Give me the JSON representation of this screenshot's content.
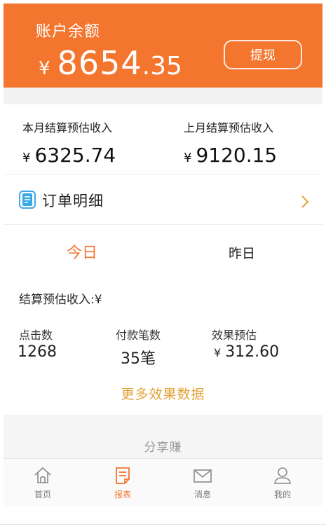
{
  "balance": {
    "label": "账户余额",
    "currency": "¥",
    "integer": "8654",
    "decimal": ".35",
    "withdraw_label": "提现"
  },
  "month_stats": {
    "this_month_label": "本月结算预估收入",
    "this_month_currency": "¥",
    "this_month_value": "6325.74",
    "last_month_label": "上月结算预估收入",
    "last_month_currency": "¥",
    "last_month_value": "9120.15"
  },
  "order_detail": {
    "label": "订单明细"
  },
  "tabs": {
    "today": "今日",
    "yesterday": "昨日"
  },
  "settle": {
    "label": "结算预估收入:¥"
  },
  "stats": {
    "clicks_label": "点击数",
    "clicks_value": "1268",
    "payments_label": "付款笔数",
    "payments_value": "35笔",
    "effect_label": "效果预估",
    "effect_currency": "¥",
    "effect_value": "312.60"
  },
  "more_link": "更多效果数据",
  "share": {
    "label": "分享赚"
  },
  "nav": {
    "items": [
      {
        "label": "首页",
        "icon": "home-icon"
      },
      {
        "label": "报表",
        "icon": "report-icon"
      },
      {
        "label": "消息",
        "icon": "mail-icon"
      },
      {
        "label": "我的",
        "icon": "user-icon"
      }
    ],
    "active_index": 1
  },
  "colors": {
    "brand": "#f3752e",
    "accent_link": "#e2a33a",
    "order_icon": "#3aa9e8"
  }
}
